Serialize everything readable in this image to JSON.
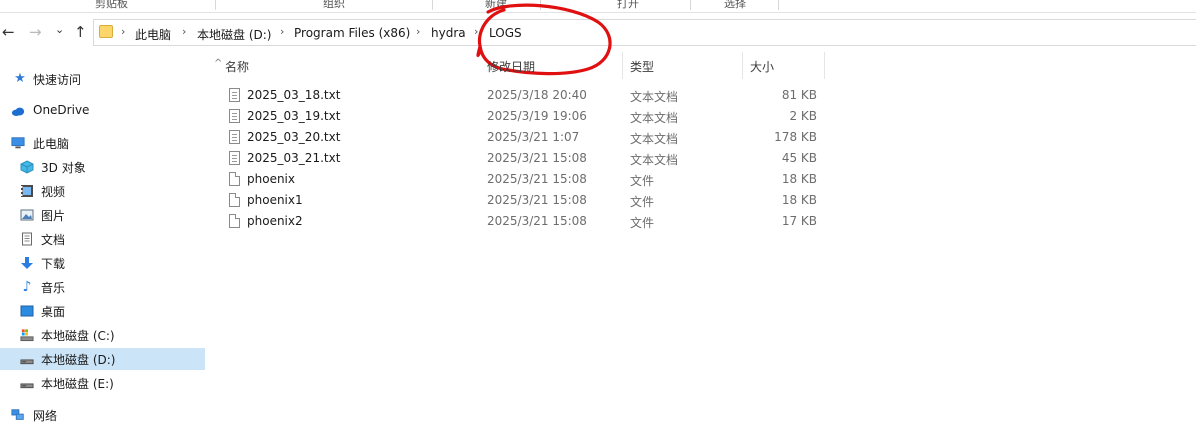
{
  "ribbon": {
    "labels": [
      "剪贴板",
      "组织",
      "新建",
      "打开",
      "选择"
    ]
  },
  "nav": {
    "back": "←",
    "forward": "→",
    "dropdown": "⌄",
    "up": "↑"
  },
  "breadcrumb": {
    "separator": "›",
    "items": [
      "此电脑",
      "本地磁盘 (D:)",
      "Program Files (x86)",
      "hydra",
      "LOGS"
    ]
  },
  "sidebar": {
    "items": [
      {
        "label": "快速访问",
        "icon": "star-icon"
      },
      {
        "label": "OneDrive",
        "icon": "cloud-icon"
      },
      {
        "label": "此电脑",
        "icon": "computer-icon"
      },
      {
        "label": "3D 对象",
        "icon": "cube-icon"
      },
      {
        "label": "视频",
        "icon": "video-icon"
      },
      {
        "label": "图片",
        "icon": "picture-icon"
      },
      {
        "label": "文档",
        "icon": "document-icon"
      },
      {
        "label": "下载",
        "icon": "download-icon"
      },
      {
        "label": "音乐",
        "icon": "music-icon"
      },
      {
        "label": "桌面",
        "icon": "desktop-icon"
      },
      {
        "label": "本地磁盘 (C:)",
        "icon": "drive-icon"
      },
      {
        "label": "本地磁盘 (D:)",
        "icon": "drive-icon",
        "selected": true
      },
      {
        "label": "本地磁盘 (E:)",
        "icon": "drive-icon"
      },
      {
        "label": "网络",
        "icon": "network-icon"
      }
    ]
  },
  "columns": {
    "name": "名称",
    "date": "修改日期",
    "type": "类型",
    "size": "大小",
    "sort_arrow": "^"
  },
  "files": [
    {
      "name": "2025_03_18.txt",
      "date": "2025/3/18 20:40",
      "type": "文本文档",
      "size": "81 KB",
      "icon": "text-file-icon"
    },
    {
      "name": "2025_03_19.txt",
      "date": "2025/3/19 19:06",
      "type": "文本文档",
      "size": "2 KB",
      "icon": "text-file-icon"
    },
    {
      "name": "2025_03_20.txt",
      "date": "2025/3/21 1:07",
      "type": "文本文档",
      "size": "178 KB",
      "icon": "text-file-icon"
    },
    {
      "name": "2025_03_21.txt",
      "date": "2025/3/21 15:08",
      "type": "文本文档",
      "size": "45 KB",
      "icon": "text-file-icon"
    },
    {
      "name": "phoenix",
      "date": "2025/3/21 15:08",
      "type": "文件",
      "size": "18 KB",
      "icon": "file-icon"
    },
    {
      "name": "phoenix1",
      "date": "2025/3/21 15:08",
      "type": "文件",
      "size": "18 KB",
      "icon": "file-icon"
    },
    {
      "name": "phoenix2",
      "date": "2025/3/21 15:08",
      "type": "文件",
      "size": "17 KB",
      "icon": "file-icon"
    }
  ],
  "colors": {
    "selected_bg": "#cce4f7",
    "annotation": "#e01010",
    "folder": "#fcd66b"
  }
}
